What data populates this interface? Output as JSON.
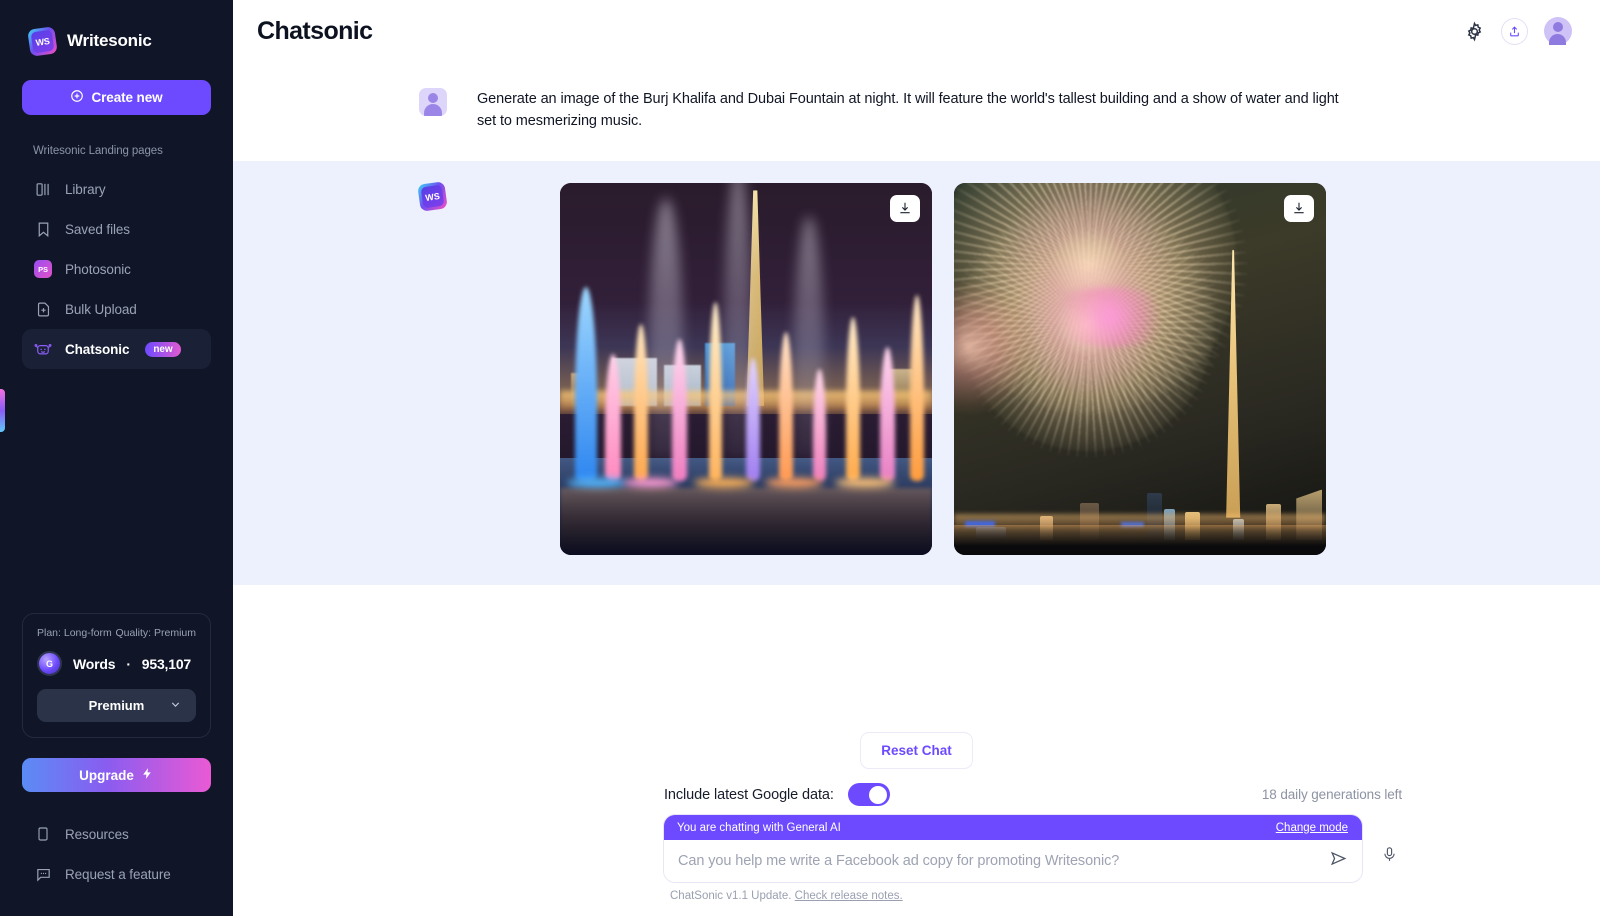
{
  "sidebar": {
    "brand": "Writesonic",
    "brand_logo_text": "WS",
    "create_new": "Create new",
    "section_label": "Writesonic Landing pages",
    "items": [
      {
        "label": "Library",
        "icon": "library-icon",
        "active": false
      },
      {
        "label": "Saved files",
        "icon": "bookmark-icon",
        "active": false
      },
      {
        "label": "Photosonic",
        "icon": "photosonic-icon",
        "active": false
      },
      {
        "label": "Bulk Upload",
        "icon": "file-plus-icon",
        "active": false
      },
      {
        "label": "Chatsonic",
        "icon": "robot-icon",
        "active": true,
        "badge": "new"
      }
    ],
    "plan_card": {
      "plan": "Plan: Long-form",
      "quality": "Quality: Premium",
      "words_label": "Words",
      "words_separator": "·",
      "words_value": "953,107",
      "quality_button": "Premium",
      "coin_letter": "G"
    },
    "upgrade": "Upgrade",
    "bottom_items": [
      {
        "label": "Resources",
        "icon": "book-icon"
      },
      {
        "label": "Request a feature",
        "icon": "comment-icon"
      }
    ]
  },
  "header": {
    "title": "Chatsonic",
    "settings_icon": "gear-icon",
    "share_icon": "share-icon",
    "avatar": "user-avatar"
  },
  "conversation": {
    "user_message": "Generate an image of the Burj Khalifa and Dubai Fountain at night. It will feature the world's tallest building and a show of water and light set to mesmerizing music.",
    "bot_logo_text": "WS",
    "images": [
      {
        "alt": "Dubai Fountain light show at night with Burj Khalifa",
        "download_label": "Download"
      },
      {
        "alt": "Fireworks over Burj Khalifa at night",
        "download_label": "Download"
      }
    ]
  },
  "composer": {
    "reset_chat": "Reset Chat",
    "google_data_label": "Include latest Google data:",
    "google_data_enabled": true,
    "generations_left": "18 daily generations left",
    "mode_text": "You are chatting with General AI",
    "change_mode": "Change mode",
    "input_value": "",
    "input_placeholder": "Can you help me write a Facebook ad copy for promoting Writesonic?",
    "send_icon": "send-icon",
    "mic_icon": "microphone-icon",
    "footer_note_prefix": "ChatSonic v1.1 Update. ",
    "footer_note_link": "Check release notes."
  },
  "colors": {
    "accent": "#6d4aff",
    "sidebar_bg": "#101628",
    "bot_section_bg": "#edf0fd",
    "badge_gradient_start": "#6d4aff",
    "badge_gradient_end": "#e05ad0"
  }
}
